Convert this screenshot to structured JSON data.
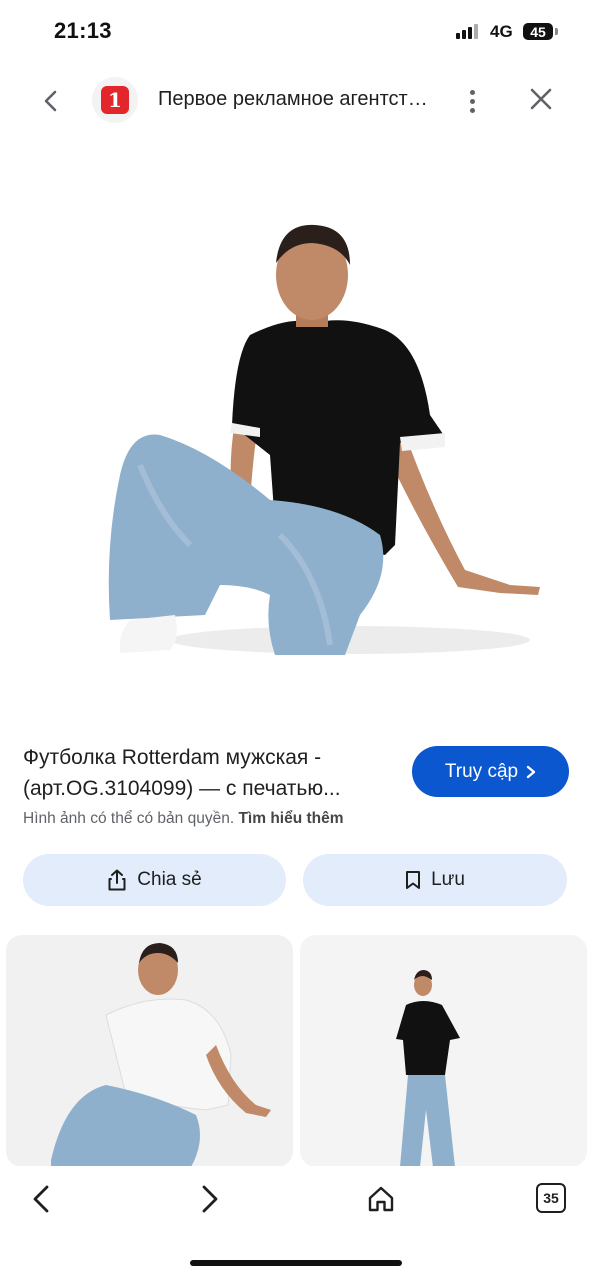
{
  "status": {
    "time": "21:13",
    "network": "4G",
    "battery": "45"
  },
  "header": {
    "site_title": "Первое рекламное агентство",
    "logo_glyph": "1",
    "logo_color": "#e3262b"
  },
  "result": {
    "title": "Футболка Rotterdam мужская - (арт.OG.3104099) — с печатью...",
    "visit_label": "Truy cập",
    "copyright_text": "Hình ảnh có thể có bản quyền.",
    "learn_more": "Tìm hiểu thêm"
  },
  "actions": {
    "share_label": "Chia sẻ",
    "save_label": "Lưu"
  },
  "bottom_nav": {
    "tab_count": "35"
  },
  "colors": {
    "accent": "#0b57d0",
    "pill_bg": "#e2ecfb",
    "shirt": "#111111",
    "jeans": "#8fb0cc"
  }
}
